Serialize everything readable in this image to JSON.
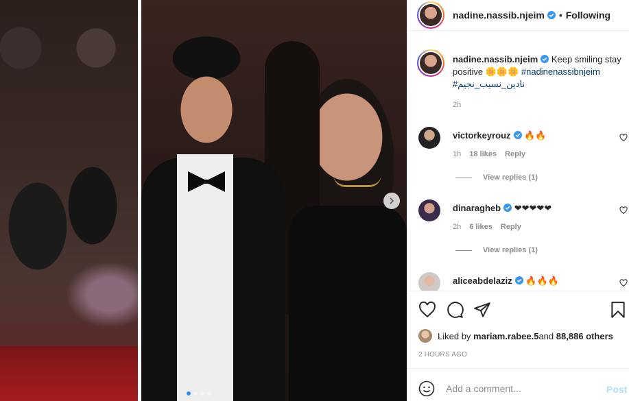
{
  "post": {
    "author": "nadine.nassib.njeim",
    "follow_separator": "•",
    "follow_state": "Following",
    "caption_text": " Keep smiling stay positive 🌼🌼🌼 ",
    "caption_tag_1": "#nadinenassibnjeim",
    "caption_tag_2": "#نادين_نسيب_نجيم",
    "caption_time": "2h",
    "carousel": {
      "slide_count": 4,
      "active_slide": 1
    }
  },
  "comments": [
    {
      "user": "victorkeyrouz",
      "text": "🔥🔥",
      "time": "1h",
      "likes": "18 likes",
      "reply": "Reply",
      "view_replies": "View replies (1)"
    },
    {
      "user": "dinaragheb",
      "text": "❤❤❤❤❤",
      "time": "2h",
      "likes": "6 likes",
      "reply": "Reply",
      "view_replies": "View replies (1)"
    },
    {
      "user": "aliceabdelaziz",
      "text": "🔥🔥🔥"
    }
  ],
  "likes": {
    "prefix": "Liked by ",
    "first_user": "mariam.rabee.5",
    "connector": " and ",
    "others": "88,886 others"
  },
  "posted_ago": "2 HOURS AGO",
  "add_comment": {
    "placeholder": "Add a comment...",
    "post_label": "Post"
  },
  "colors": {
    "link_blue": "#00376b",
    "verified_blue": "#3897f0",
    "muted": "#8e8e8e",
    "post_disabled": "#b2dffc"
  },
  "icons": [
    "verified-badge-icon",
    "chevron-right-icon",
    "heart-icon",
    "comment-icon",
    "share-icon",
    "bookmark-icon",
    "emoji-icon"
  ]
}
